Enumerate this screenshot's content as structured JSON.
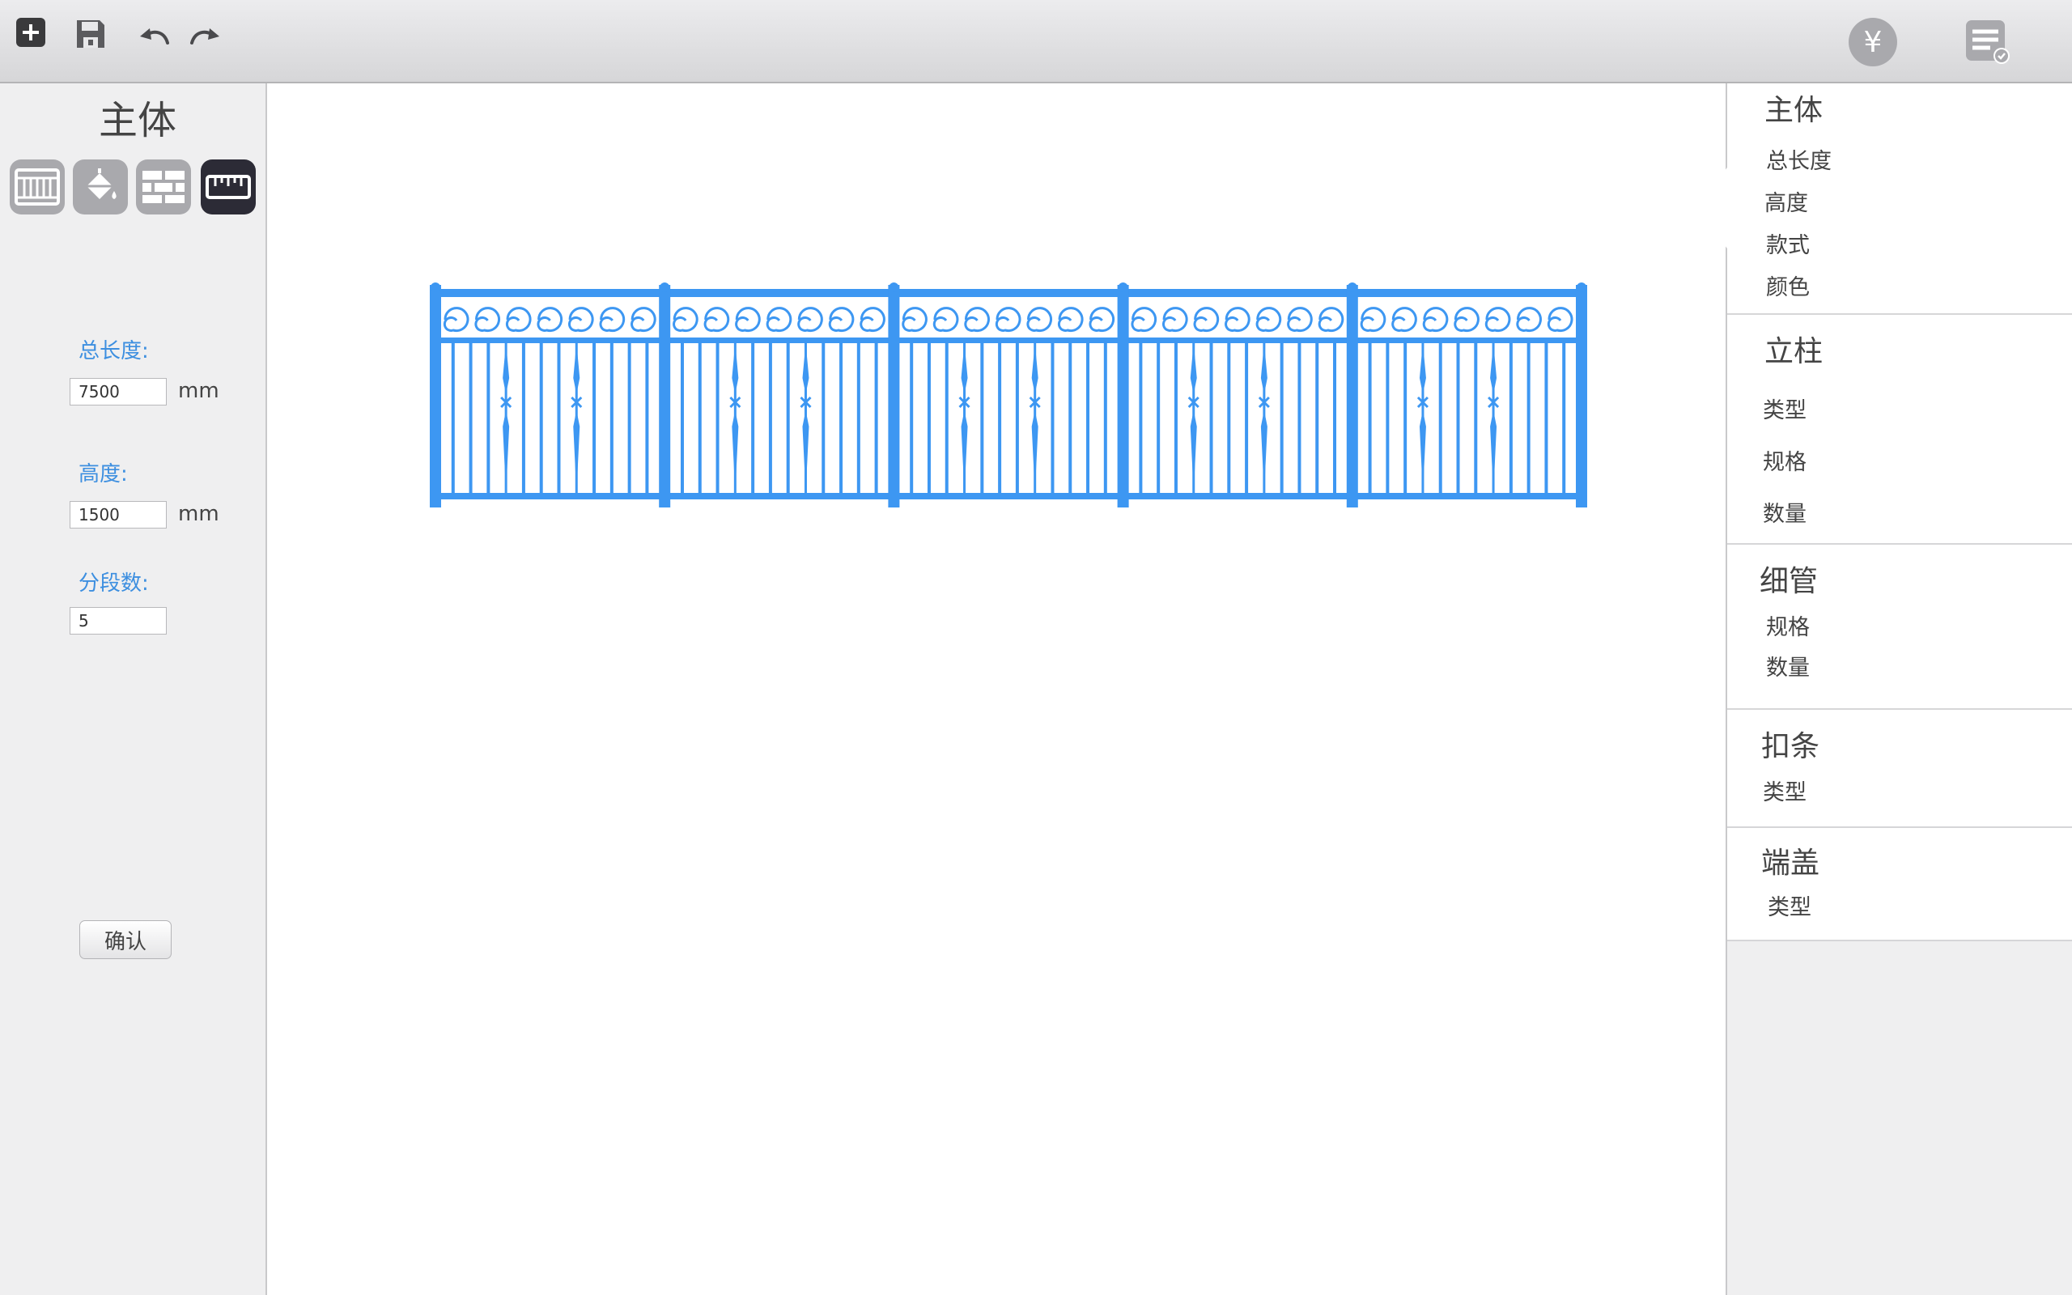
{
  "toolbar": {
    "icons": [
      "add-icon",
      "save-icon",
      "undo-icon",
      "redo-icon",
      "price-icon",
      "order-list-icon"
    ],
    "price_symbol": "¥"
  },
  "left_panel": {
    "title": "主体",
    "modes": [
      "railing-style-icon",
      "paint-bucket-icon",
      "brick-wall-icon",
      "ruler-icon"
    ],
    "active_mode": "ruler-icon",
    "fields": {
      "total_length": {
        "label": "总长度:",
        "value": "7500",
        "unit": "mm"
      },
      "height": {
        "label": "高度:",
        "value": "1500",
        "unit": "mm"
      },
      "segments": {
        "label": "分段数:",
        "value": "5"
      }
    },
    "confirm_label": "确认"
  },
  "canvas": {
    "railing": {
      "segments": 5,
      "color": "#3d97f2"
    }
  },
  "right_panel": {
    "sections": [
      {
        "title": "主体",
        "items": [
          "总长度",
          "高度",
          "款式",
          "颜色"
        ]
      },
      {
        "title": "立柱",
        "items": [
          "类型",
          "规格",
          "数量"
        ]
      },
      {
        "title": "细管",
        "items": [
          "规格",
          "数量"
        ]
      },
      {
        "title": "扣条",
        "items": [
          "类型"
        ]
      },
      {
        "title": "端盖",
        "items": [
          "类型"
        ]
      }
    ]
  },
  "colors": {
    "accent": "#3d8fe0",
    "railing": "#3d97f2",
    "panel": "#efeff0"
  }
}
